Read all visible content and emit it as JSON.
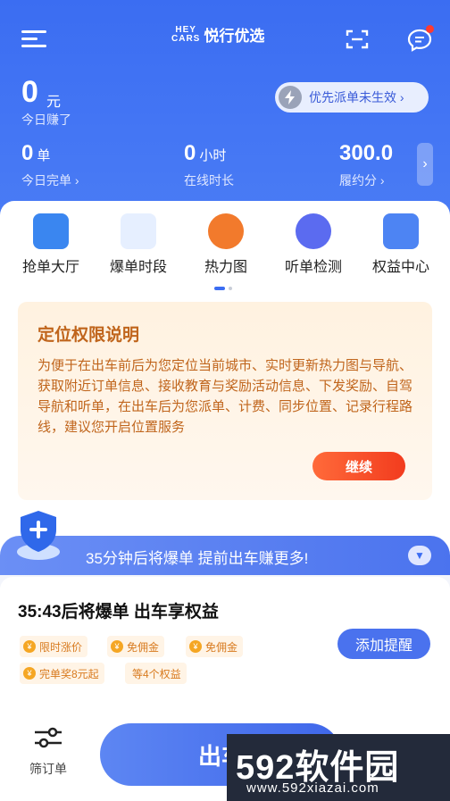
{
  "header": {
    "brand_logo_line1": "HEY",
    "brand_logo_line2": "CARS",
    "brand_name": "悦行优选",
    "today_earn_value": "0",
    "today_earn_unit": "元",
    "today_earn_label": "今日赚了",
    "priority_text": "优先派单未生效 ›"
  },
  "stats": [
    {
      "value": "0",
      "unit": "单",
      "label": "今日完单 ›"
    },
    {
      "value": "0",
      "unit": "小时",
      "label": "在线时长"
    },
    {
      "value": "300.0",
      "unit": "",
      "label": "履约分 ›"
    }
  ],
  "tools": [
    {
      "label": "抢单大厅",
      "icon": "grab-order-icon",
      "color": "#3a86f0"
    },
    {
      "label": "爆单时段",
      "icon": "weather-icon",
      "color": "#6fa6ee"
    },
    {
      "label": "热力图",
      "icon": "fire-icon",
      "color": "#f27a2c"
    },
    {
      "label": "听单检测",
      "icon": "wave-icon",
      "color": "#5b6bf0"
    },
    {
      "label": "权益中心",
      "icon": "crown-icon",
      "color": "#4d84f3"
    }
  ],
  "notice": {
    "title": "定位权限说明",
    "body": "为便于在出车前后为您定位当前城市、实时更新热力图与导航、获取附近订单信息、接收教育与奖励活动信息、下发奖励、自驾导航和听单，在出车后为您派单、计费、同步位置、记录行程路线，建议您开启位置服务",
    "button": "继续"
  },
  "banner": {
    "text": "35分钟后将爆单 提前出车赚更多!"
  },
  "card": {
    "title": "35:43后将爆单 出车享权益",
    "add_reminder": "添加提醒",
    "tags": [
      "限时涨价",
      "免佣金",
      "免佣金",
      "完单奖8元起",
      "等4个权益"
    ]
  },
  "bottom": {
    "filter_label": "筛订单",
    "start_label": "出车"
  },
  "watermark": {
    "main": "592软件园",
    "sub": "www.592xiazai.com"
  }
}
